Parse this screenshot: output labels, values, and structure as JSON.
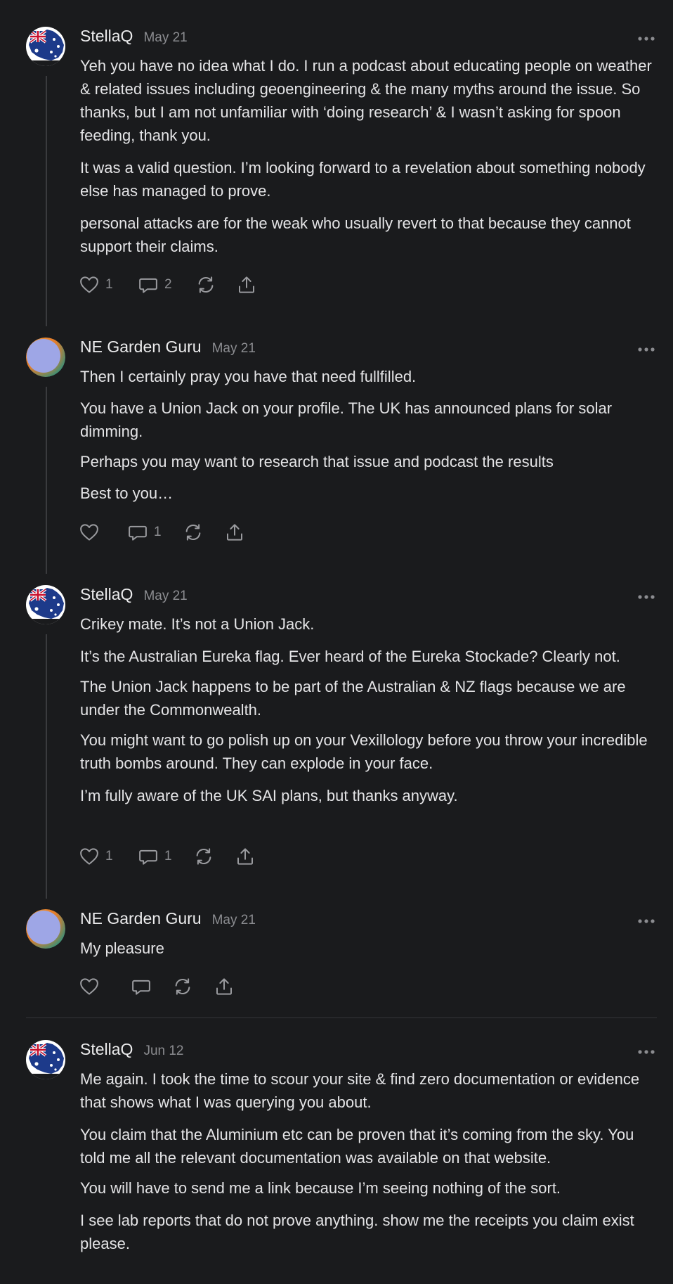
{
  "colors": {
    "background": "#1a1b1d",
    "text": "#e4e4e6",
    "muted": "#8b8c90",
    "thread_line": "#3a3b3e"
  },
  "comments": [
    {
      "author": "StellaQ",
      "date": "May 21",
      "avatar": "eureka-flag-avatar",
      "paragraphs": [
        "Yeh you have no idea what I do. I run a podcast about educating people on weather & related issues including geoengineering & the many myths around the issue. So thanks, but I am not unfamiliar with ‘doing research’ & I wasn’t asking for spoon feeding, thank you.",
        "It was a valid question. I’m looking forward to a revelation about something nobody else has managed to prove.",
        "personal attacks are for the weak who usually revert to that because they cannot support their claims."
      ],
      "likes": "1",
      "replies": "2"
    },
    {
      "author": "NE Garden Guru",
      "date": "May 21",
      "avatar": "orange-gradient-avatar",
      "paragraphs": [
        "Then I certainly pray you have that need fullfilled.",
        "You have a Union Jack on your profile. The UK has announced plans for solar dimming.",
        "Perhaps you may want to research that issue and podcast the results",
        "Best to you…"
      ],
      "likes": "",
      "replies": "1"
    },
    {
      "author": "StellaQ",
      "date": "May 21",
      "avatar": "eureka-flag-avatar",
      "paragraphs": [
        "Crikey mate. It’s not a Union Jack.",
        "It’s the Australian Eureka flag. Ever heard of the Eureka Stockade? Clearly not.",
        "The Union Jack happens to be part of the Australian & NZ flags because we are under the Commonwealth.",
        "You might want to go polish up on your Vexillology before you throw your incredible truth bombs around. They can explode in your face.",
        "I’m fully aware of the UK SAI plans, but thanks anyway."
      ],
      "likes": "1",
      "replies": "1"
    },
    {
      "author": "NE Garden Guru",
      "date": "May 21",
      "avatar": "orange-gradient-avatar",
      "paragraphs": [
        "My pleasure"
      ],
      "likes": "",
      "replies": ""
    },
    {
      "author": "StellaQ",
      "date": "Jun 12",
      "avatar": "eureka-flag-avatar",
      "paragraphs": [
        "Me again. I took the time to scour your site & find zero documentation or evidence that shows what I was querying you about.",
        "You claim that the Aluminium etc can be proven that it’s coming from the sky. You told me all the relevant documentation was available on that website.",
        "You will have to send me a link because I’m seeing nothing of the sort.",
        "I see lab reports that do not prove anything. show me the receipts you claim exist please."
      ]
    }
  ]
}
